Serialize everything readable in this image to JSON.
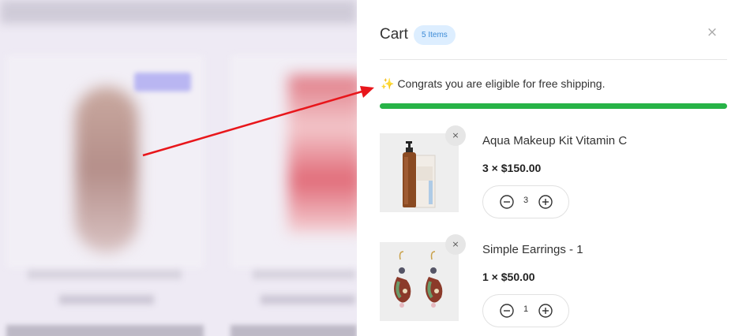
{
  "cart": {
    "title": "Cart",
    "item_count_label": "5 Items",
    "close_label": "×",
    "shipping": {
      "message": "Congrats you are eligible for free shipping.",
      "sparkle": "✨",
      "progress_percent": 100,
      "progress_color": "#27b347"
    },
    "items": [
      {
        "name": "Aqua Makeup Kit Vitamin C",
        "quantity": "3",
        "price_line": "3 × $150.00",
        "image_icon": "pump-bottle-with-box",
        "remove_label": "×"
      },
      {
        "name": "Simple Earrings - 1",
        "quantity": "1",
        "price_line": "1 × $50.00",
        "image_icon": "earrings-pair",
        "remove_label": "×"
      }
    ]
  },
  "colors": {
    "badge_bg": "#ddeeff",
    "badge_text": "#3d8bd6",
    "arrow": "#e8161b"
  }
}
